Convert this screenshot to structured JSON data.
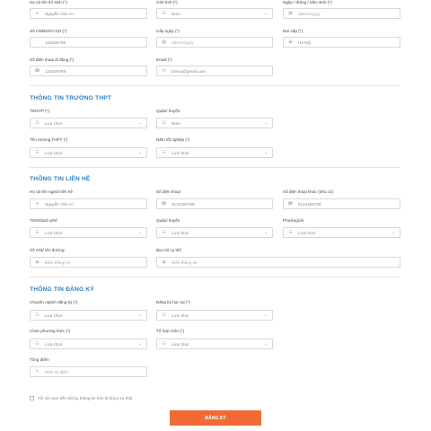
{
  "personal": {
    "fullname": {
      "label": "Họ và tên thí sinh (*)",
      "value": "Nguyễn Văn An"
    },
    "gender": {
      "label": "Giới tính (*)",
      "value": "Nam"
    },
    "dob": {
      "label": "Ngày / tháng / năm sinh (*)",
      "placeholder": "dd/mm/yyyy"
    },
    "id_number": {
      "label": "Số CMND/CCCD (*)",
      "value": "123456789"
    },
    "issue_date": {
      "label": "Cấp ngày (*)",
      "placeholder": "dd/mm/yyyy"
    },
    "issue_place": {
      "label": "Nơi cấp (*)",
      "value": "Hà Nội"
    },
    "phone": {
      "label": "Số điện thoại di động (*)",
      "value": "123456789"
    },
    "email": {
      "label": "Email (*)",
      "value": "Demo@gmail.com"
    }
  },
  "school_section": {
    "title": "THÔNG TIN TRƯỜNG THPT",
    "province": {
      "label": "Tỉnh/TP (*)",
      "value": "Lựa chọn"
    },
    "district": {
      "label": "Quận/ huyện",
      "value": "Nam"
    },
    "school": {
      "label": "Tên trường THPT (*)",
      "value": "Lựa chọn"
    },
    "grad_year": {
      "label": "Năm tốt nghiệp (*)",
      "value": "Lựa chọn"
    }
  },
  "contact_section": {
    "title": "THÔNG TIN LIÊN HỆ",
    "contact_name": {
      "label": "Họ và tên người liên hệ",
      "value": "Nguyễn Văn An"
    },
    "contact_phone": {
      "label": "Số điện thoại",
      "value": "0123456789"
    },
    "other_phone": {
      "label": "Số điện thoại khác (nếu có)",
      "value": "0123456789"
    },
    "city": {
      "label": "Tỉnh/thành phố",
      "value": "Lựa chọn"
    },
    "district": {
      "label": "Quận/ huyện",
      "value": "Lựa chọn"
    },
    "ward": {
      "label": "Phường/xã",
      "value": "Lựa chọn"
    },
    "street": {
      "label": "Số nhà/ tên đường",
      "placeholder": "Điền thông tin"
    },
    "address": {
      "label": "Địa chỉ cụ thể",
      "placeholder": "Điền thông tin"
    }
  },
  "register_section": {
    "title": "THÔNG TIN ĐĂNG KÝ",
    "major": {
      "label": "Chuyên ngành đăng ký (*)",
      "value": "Lựa chọn"
    },
    "campus": {
      "label": "Đăng ký học tại (*)",
      "value": "Lựa chọn"
    },
    "method": {
      "label": "Chọn phương thức (*)",
      "value": "Lựa chọn"
    },
    "combo": {
      "label": "Tổ hợp môn (*)",
      "value": "Lựa chọn"
    },
    "total": {
      "label": "Tổng điểm",
      "placeholder": "Điền số điểm"
    }
  },
  "agreement": {
    "text": "Tôi xin cam kết những thông tin trên là đúng sự thật"
  },
  "submit": {
    "label": "ĐĂNG KÝ"
  },
  "colors": {
    "accent": "#2a7fc4",
    "button": "#f26a35",
    "border": "#d8d8d8"
  },
  "icons": {
    "person": "user-icon",
    "calendar": "calendar-icon",
    "id": "id-card-icon",
    "location": "location-icon",
    "phone": "phone-icon",
    "email": "email-icon",
    "list": "list-icon",
    "dropdown": "chevron-down-icon"
  }
}
